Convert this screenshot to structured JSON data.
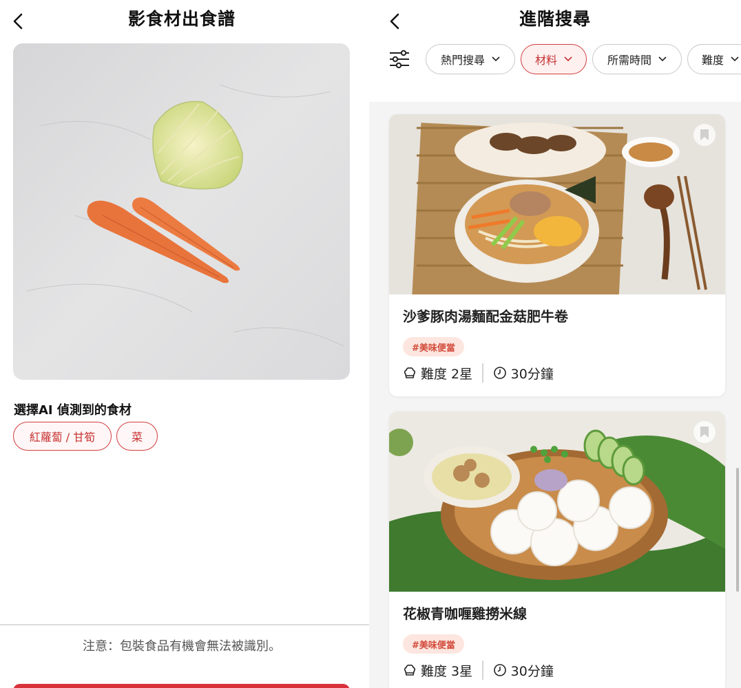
{
  "left": {
    "title": "影食材出食譜",
    "ai_section_label": "選擇AI 偵測到的食材",
    "chips": [
      {
        "label": "紅蘿蔔 / 甘筍"
      },
      {
        "label": "菜"
      }
    ],
    "notice": "注意：包裝食品有機會無法被識別。"
  },
  "right": {
    "title": "進階搜尋",
    "filters": [
      {
        "label": "熱門搜尋",
        "active": false
      },
      {
        "label": "材料",
        "active": true
      },
      {
        "label": "所需時間",
        "active": false
      },
      {
        "label": "難度",
        "active": false
      }
    ],
    "recipes": [
      {
        "title": "沙爹豚肉湯麵配金菇肥牛卷",
        "tag": "#美味便當",
        "difficulty": "難度 2星",
        "time": "30分鐘"
      },
      {
        "title": "花椒青咖喱雞撈米線",
        "tag": "#美味便當",
        "difficulty": "難度 3星",
        "time": "30分鐘"
      }
    ]
  },
  "colors": {
    "accent": "#d8313a",
    "tag_bg": "#fde6df",
    "chip_border": "#d23c3c"
  },
  "icons": [
    "back-arrow-icon",
    "filter-sliders-icon",
    "chevron-down-icon",
    "bookmark-icon",
    "chef-hat-icon",
    "clock-icon"
  ]
}
